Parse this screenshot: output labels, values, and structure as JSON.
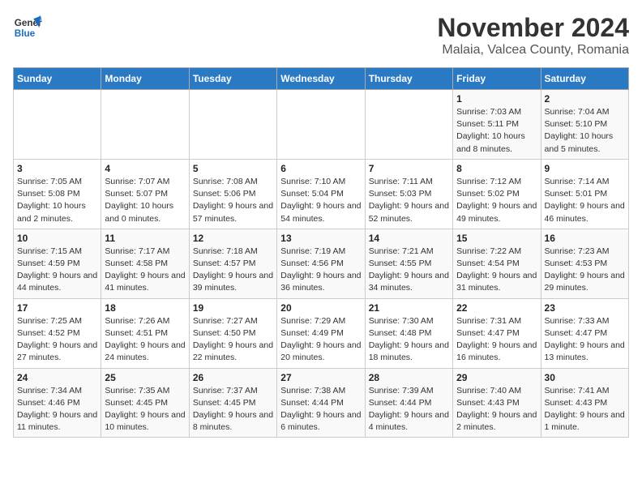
{
  "logo": {
    "line1": "General",
    "line2": "Blue"
  },
  "title": "November 2024",
  "subtitle": "Malaia, Valcea County, Romania",
  "weekdays": [
    "Sunday",
    "Monday",
    "Tuesday",
    "Wednesday",
    "Thursday",
    "Friday",
    "Saturday"
  ],
  "weeks": [
    [
      {
        "day": "",
        "info": ""
      },
      {
        "day": "",
        "info": ""
      },
      {
        "day": "",
        "info": ""
      },
      {
        "day": "",
        "info": ""
      },
      {
        "day": "",
        "info": ""
      },
      {
        "day": "1",
        "info": "Sunrise: 7:03 AM\nSunset: 5:11 PM\nDaylight: 10 hours and 8 minutes."
      },
      {
        "day": "2",
        "info": "Sunrise: 7:04 AM\nSunset: 5:10 PM\nDaylight: 10 hours and 5 minutes."
      }
    ],
    [
      {
        "day": "3",
        "info": "Sunrise: 7:05 AM\nSunset: 5:08 PM\nDaylight: 10 hours and 2 minutes."
      },
      {
        "day": "4",
        "info": "Sunrise: 7:07 AM\nSunset: 5:07 PM\nDaylight: 10 hours and 0 minutes."
      },
      {
        "day": "5",
        "info": "Sunrise: 7:08 AM\nSunset: 5:06 PM\nDaylight: 9 hours and 57 minutes."
      },
      {
        "day": "6",
        "info": "Sunrise: 7:10 AM\nSunset: 5:04 PM\nDaylight: 9 hours and 54 minutes."
      },
      {
        "day": "7",
        "info": "Sunrise: 7:11 AM\nSunset: 5:03 PM\nDaylight: 9 hours and 52 minutes."
      },
      {
        "day": "8",
        "info": "Sunrise: 7:12 AM\nSunset: 5:02 PM\nDaylight: 9 hours and 49 minutes."
      },
      {
        "day": "9",
        "info": "Sunrise: 7:14 AM\nSunset: 5:01 PM\nDaylight: 9 hours and 46 minutes."
      }
    ],
    [
      {
        "day": "10",
        "info": "Sunrise: 7:15 AM\nSunset: 4:59 PM\nDaylight: 9 hours and 44 minutes."
      },
      {
        "day": "11",
        "info": "Sunrise: 7:17 AM\nSunset: 4:58 PM\nDaylight: 9 hours and 41 minutes."
      },
      {
        "day": "12",
        "info": "Sunrise: 7:18 AM\nSunset: 4:57 PM\nDaylight: 9 hours and 39 minutes."
      },
      {
        "day": "13",
        "info": "Sunrise: 7:19 AM\nSunset: 4:56 PM\nDaylight: 9 hours and 36 minutes."
      },
      {
        "day": "14",
        "info": "Sunrise: 7:21 AM\nSunset: 4:55 PM\nDaylight: 9 hours and 34 minutes."
      },
      {
        "day": "15",
        "info": "Sunrise: 7:22 AM\nSunset: 4:54 PM\nDaylight: 9 hours and 31 minutes."
      },
      {
        "day": "16",
        "info": "Sunrise: 7:23 AM\nSunset: 4:53 PM\nDaylight: 9 hours and 29 minutes."
      }
    ],
    [
      {
        "day": "17",
        "info": "Sunrise: 7:25 AM\nSunset: 4:52 PM\nDaylight: 9 hours and 27 minutes."
      },
      {
        "day": "18",
        "info": "Sunrise: 7:26 AM\nSunset: 4:51 PM\nDaylight: 9 hours and 24 minutes."
      },
      {
        "day": "19",
        "info": "Sunrise: 7:27 AM\nSunset: 4:50 PM\nDaylight: 9 hours and 22 minutes."
      },
      {
        "day": "20",
        "info": "Sunrise: 7:29 AM\nSunset: 4:49 PM\nDaylight: 9 hours and 20 minutes."
      },
      {
        "day": "21",
        "info": "Sunrise: 7:30 AM\nSunset: 4:48 PM\nDaylight: 9 hours and 18 minutes."
      },
      {
        "day": "22",
        "info": "Sunrise: 7:31 AM\nSunset: 4:47 PM\nDaylight: 9 hours and 16 minutes."
      },
      {
        "day": "23",
        "info": "Sunrise: 7:33 AM\nSunset: 4:47 PM\nDaylight: 9 hours and 13 minutes."
      }
    ],
    [
      {
        "day": "24",
        "info": "Sunrise: 7:34 AM\nSunset: 4:46 PM\nDaylight: 9 hours and 11 minutes."
      },
      {
        "day": "25",
        "info": "Sunrise: 7:35 AM\nSunset: 4:45 PM\nDaylight: 9 hours and 10 minutes."
      },
      {
        "day": "26",
        "info": "Sunrise: 7:37 AM\nSunset: 4:45 PM\nDaylight: 9 hours and 8 minutes."
      },
      {
        "day": "27",
        "info": "Sunrise: 7:38 AM\nSunset: 4:44 PM\nDaylight: 9 hours and 6 minutes."
      },
      {
        "day": "28",
        "info": "Sunrise: 7:39 AM\nSunset: 4:44 PM\nDaylight: 9 hours and 4 minutes."
      },
      {
        "day": "29",
        "info": "Sunrise: 7:40 AM\nSunset: 4:43 PM\nDaylight: 9 hours and 2 minutes."
      },
      {
        "day": "30",
        "info": "Sunrise: 7:41 AM\nSunset: 4:43 PM\nDaylight: 9 hours and 1 minute."
      }
    ]
  ]
}
